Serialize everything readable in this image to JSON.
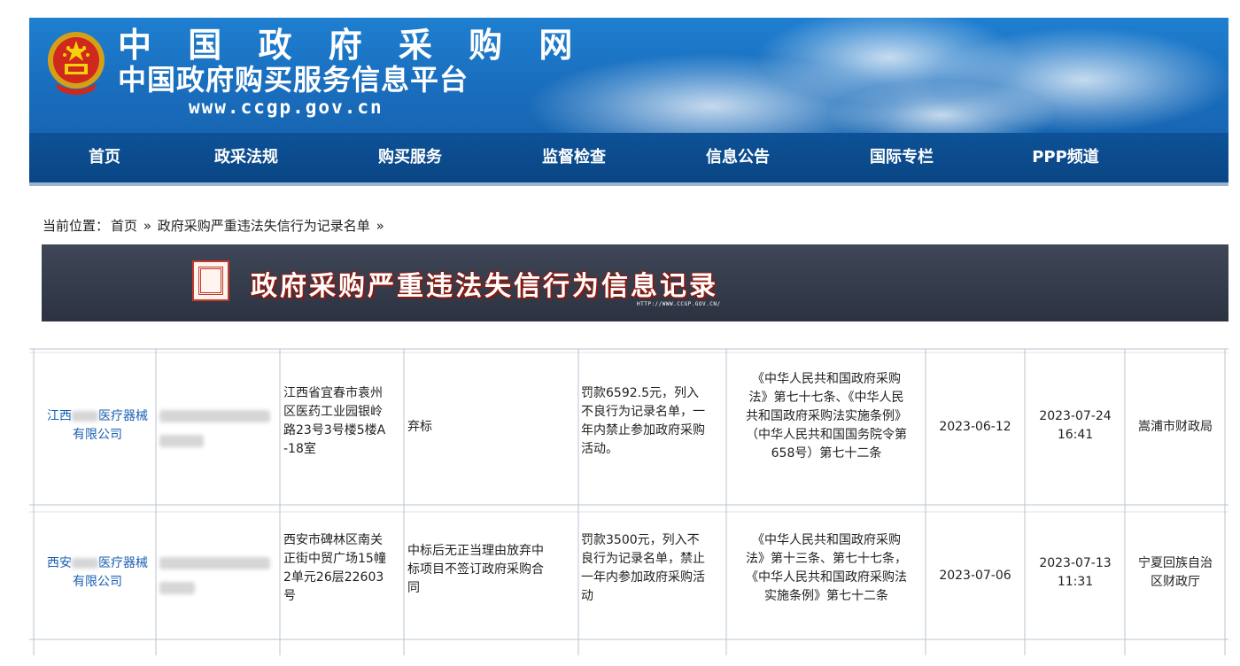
{
  "site": {
    "title_line1": "中 国 政 府 采 购 网",
    "title_line2": "中国政府购买服务信息平台",
    "url": "www.ccgp.gov.cn"
  },
  "nav": [
    "首页",
    "政采法规",
    "购买服务",
    "监督检查",
    "信息公告",
    "国际专栏",
    "PPP频道"
  ],
  "breadcrumb": {
    "label": "当前位置：",
    "home": "首页",
    "sep1": "»",
    "page": "政府采购严重违法失信行为记录名单",
    "sep2": "»"
  },
  "banner": {
    "title": "政府采购严重违法失信行为信息记录",
    "url": "HTTP://WWW.CCGP.GOV.CN/"
  },
  "records": [
    {
      "company_a": "江西",
      "company_b": "医疗器械",
      "company_c": "有限公司",
      "address": [
        "江西省宜春市袁州",
        "区医药工业园银岭",
        "路23号3号楼5楼A",
        "-18室"
      ],
      "behavior": [
        "弃标"
      ],
      "penalty": [
        "罚款6592.5元，列入",
        "不良行为记录名单，一",
        "年内禁止参加政府采购",
        "活动。"
      ],
      "basis": [
        "《中华人民共和国政府采购",
        "法》第七十七条、《中华人民",
        "共和国政府采购法实施条例》",
        "（中华人民共和国国务院令第",
        "658号）第七十二条"
      ],
      "penalty_date": "2023-06-12",
      "publish_date": "2023-07-24",
      "publish_time": "16:41",
      "authority": [
        "嵩浦市财政局"
      ]
    },
    {
      "company_a": "西安",
      "company_b": "医疗器械",
      "company_c": "有限公司",
      "address": [
        "西安市碑林区南关",
        "正街中贸广场15幢",
        "2单元26层22603",
        "号"
      ],
      "behavior": [
        "中标后无正当理由放弃中",
        "标项目不签订政府采购合",
        "同"
      ],
      "penalty": [
        "罚款3500元，列入不",
        "良行为记录名单，禁止",
        "一年内参加政府采购活",
        "动"
      ],
      "basis": [
        "《中华人民共和国政府采购",
        "法》第十三条、第七十七条，",
        "《中华人民共和国政府采购法",
        "实施条例》第七十二条"
      ],
      "penalty_date": "2023-07-06",
      "publish_date": "2023-07-13",
      "publish_time": "11:31",
      "authority": [
        "宁夏回族自治",
        "区财政厅"
      ]
    }
  ],
  "colors": {
    "banner_blue": "#1a6fbf",
    "nav_blue": "#0a4583",
    "link_blue": "#1a5fb4",
    "seal_red": "#c23a2a"
  }
}
